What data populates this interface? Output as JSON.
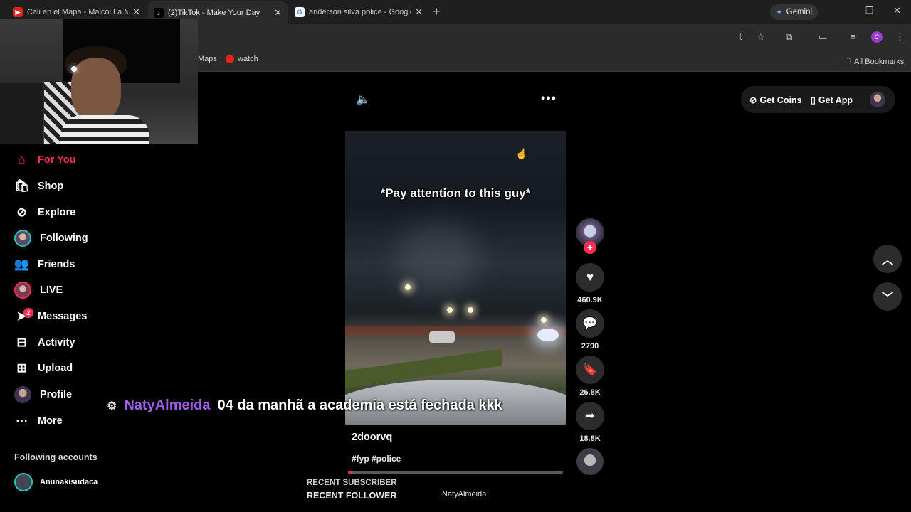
{
  "browser": {
    "tabs": [
      {
        "title": "Cali en el Mapa - Maicol La M",
        "favicon": "youtube-icon"
      },
      {
        "title": "(2)TikTok - Make Your Day",
        "favicon": "tiktok-icon"
      },
      {
        "title": "anderson silva police - Google",
        "favicon": "google-icon"
      }
    ],
    "gemini_label": "Gemini",
    "profile_initial": "C",
    "bookmarks": [
      {
        "label": "Maps"
      },
      {
        "label": "watch"
      }
    ],
    "all_bookmarks_label": "All Bookmarks"
  },
  "sidebar": {
    "items": [
      {
        "label": "For You",
        "icon": "home-icon"
      },
      {
        "label": "Shop",
        "icon": "shopping-bag-icon"
      },
      {
        "label": "Explore",
        "icon": "compass-icon"
      },
      {
        "label": "Following",
        "icon": "avatar-icon"
      },
      {
        "label": "Friends",
        "icon": "friends-icon"
      },
      {
        "label": "LIVE",
        "icon": "live-avatar-icon"
      },
      {
        "label": "Messages",
        "icon": "paper-plane-icon"
      },
      {
        "label": "Activity",
        "icon": "activity-icon"
      },
      {
        "label": "Upload",
        "icon": "plus-square-icon"
      },
      {
        "label": "Profile",
        "icon": "profile-avatar-icon"
      },
      {
        "label": "More",
        "icon": "more-dots-icon"
      }
    ],
    "messages_badge": "2",
    "following_accounts_title": "Following accounts",
    "following_accounts": [
      {
        "name": "Anunakisudaca"
      }
    ]
  },
  "top_controls": {
    "get_coins": "Get Coins",
    "get_app": "Get App"
  },
  "video": {
    "caption": "*Pay attention to this guy*",
    "author": "2doorvq",
    "hashtags": "#fyp #police",
    "progress": 0.02
  },
  "actions": {
    "likes": "460.9K",
    "comments": "2790",
    "saves": "26.8K",
    "shares": "18.8K"
  },
  "stream_overlay": {
    "chat_user": "NatyAlmeida",
    "chat_message": "04 da manhã a academia está fechada kkk",
    "recent_subscriber_label": "RECENT SUBSCRIBER",
    "recent_follower_label": "RECENT FOLLOWER",
    "recent_follower_name": "NatyAlmeida"
  },
  "colors": {
    "accent": "#fe2c55",
    "teal": "#20c5bf",
    "chat_user": "#a25cf0"
  }
}
